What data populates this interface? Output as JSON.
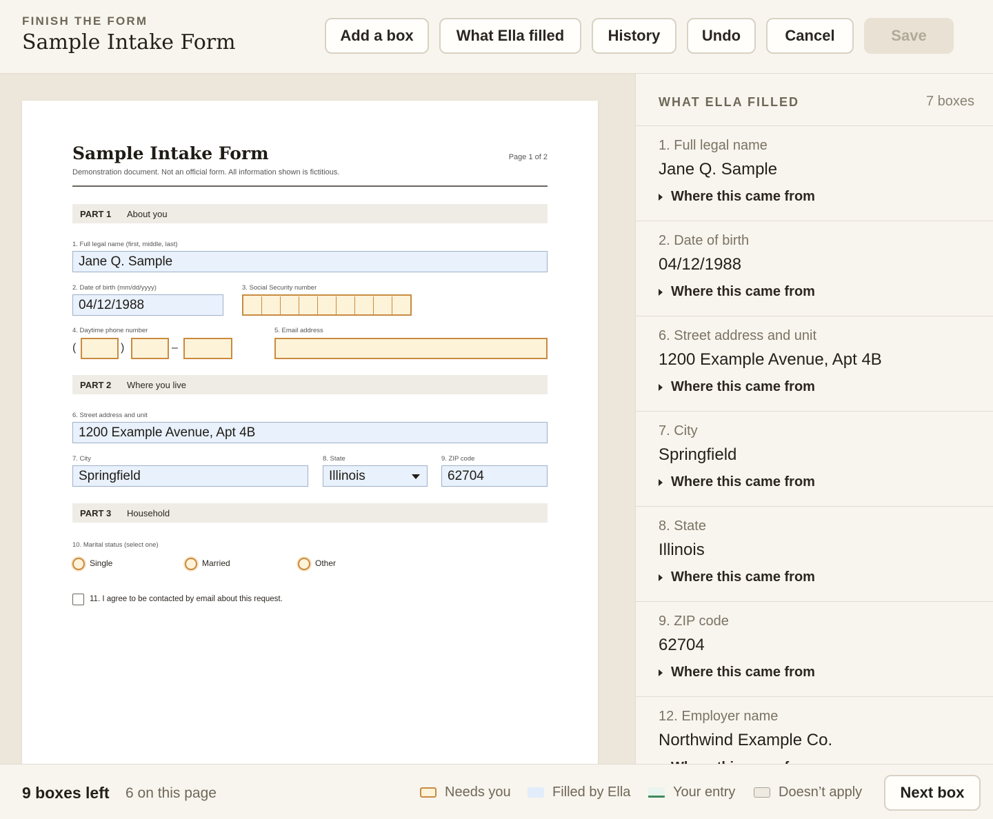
{
  "header": {
    "eyebrow": "FINISH THE FORM",
    "title": "Sample Intake Form",
    "buttons": {
      "add_box": "Add a box",
      "what_ella_filled": "What Ella filled",
      "history": "History",
      "undo": "Undo",
      "cancel": "Cancel",
      "save": "Save"
    }
  },
  "document": {
    "title": "Sample Intake Form",
    "subtitle": "Demonstration document. Not an official form. All information shown is fictitious.",
    "page": "Page 1 of 2",
    "part1": {
      "num": "PART 1",
      "name": "About you"
    },
    "part2": {
      "num": "PART 2",
      "name": "Where you live"
    },
    "part3": {
      "num": "PART 3",
      "name": "Household"
    },
    "fields": {
      "name_label": "1.  Full legal name (first, middle, last)",
      "name_value": "Jane Q. Sample",
      "dob_label": "2.  Date of birth (mm/dd/yyyy)",
      "dob_value": "04/12/1988",
      "ssn_label": "3.  Social Security number",
      "phone_label": "4.  Daytime phone number",
      "email_label": "5.  Email address",
      "street_label": "6.  Street address and unit",
      "street_value": "1200 Example Avenue, Apt 4B",
      "city_label": "7.  City",
      "city_value": "Springfield",
      "state_label": "8.  State",
      "state_value": "Illinois",
      "zip_label": "9.  ZIP code",
      "zip_value": "62704",
      "marital_label": "10.  Marital status (select one)",
      "marital_options": [
        "Single",
        "Married",
        "Other"
      ],
      "consent_label": "11.   I agree to be contacted by email about this request."
    },
    "phone_punct": {
      "open": "(",
      "close": ")",
      "dash": "–"
    }
  },
  "panel": {
    "title": "WHAT ELLA FILLED",
    "count": "7 boxes",
    "source_label": "Where this came from",
    "items": [
      {
        "label": "1. Full legal name",
        "value": "Jane Q. Sample"
      },
      {
        "label": "2. Date of birth",
        "value": "04/12/1988"
      },
      {
        "label": "6. Street address and unit",
        "value": "1200 Example Avenue, Apt 4B"
      },
      {
        "label": "7. City",
        "value": "Springfield"
      },
      {
        "label": "8. State",
        "value": "Illinois"
      },
      {
        "label": "9. ZIP code",
        "value": "62704"
      },
      {
        "label": "12. Employer name",
        "value": "Northwind Example Co."
      }
    ]
  },
  "footer": {
    "boxes_left": "9 boxes left",
    "on_page": "6 on this page",
    "legend": {
      "needs_you": "Needs you",
      "filled_by_ella": "Filled by Ella",
      "your_entry": "Your entry",
      "doesnt_apply": "Doesn’t apply"
    },
    "next_button": "Next box"
  },
  "colors": {
    "needs_you": "#c98a3f",
    "filled_by_ella": "#e8f1fc",
    "your_entry": "#3e8a5a",
    "background": "#f0ebe1"
  }
}
